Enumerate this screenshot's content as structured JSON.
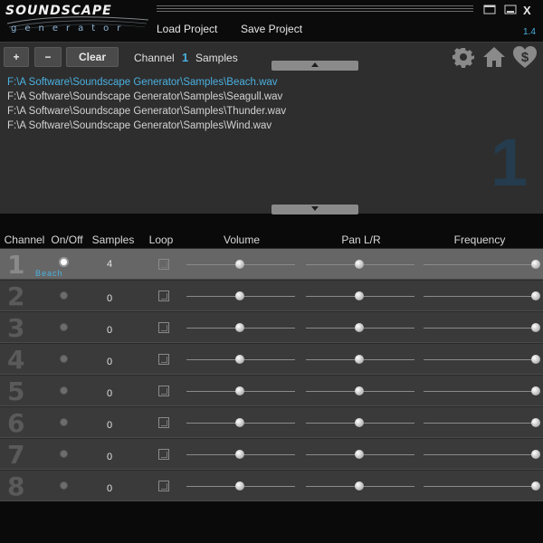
{
  "app": {
    "logo_main": "SOUNDSCAPE",
    "logo_sub": "generator",
    "version": "1.4",
    "close_label": "X"
  },
  "menu": {
    "load_project": "Load Project",
    "save_project": "Save Project"
  },
  "toolbar": {
    "add_label": "+",
    "remove_label": "−",
    "clear_label": "Clear",
    "channel_label": "Channel",
    "channel_value": "1",
    "samples_label": "Samples"
  },
  "files": [
    "F:\\A Software\\Soundscape Generator\\Samples\\Beach.wav",
    "F:\\A Software\\Soundscape Generator\\Samples\\Seagull.wav",
    "F:\\A Software\\Soundscape Generator\\Samples\\Thunder.wav",
    "F:\\A Software\\Soundscape Generator\\Samples\\Wind.wav"
  ],
  "active_file_index": 0,
  "big_channel_number": "1",
  "table": {
    "headers": {
      "channel": "Channel",
      "onoff": "On/Off",
      "samples": "Samples",
      "loop": "Loop",
      "volume": "Volume",
      "pan": "Pan L/R",
      "frequency": "Frequency"
    },
    "rows": [
      {
        "num": "1",
        "selected": true,
        "on": true,
        "sample_name": "Beach",
        "count": "4",
        "volume": 0.49,
        "pan": 0.49,
        "frequency": 1.0
      },
      {
        "num": "2",
        "selected": false,
        "on": false,
        "sample_name": "",
        "count": "0",
        "volume": 0.49,
        "pan": 0.49,
        "frequency": 1.0
      },
      {
        "num": "3",
        "selected": false,
        "on": false,
        "sample_name": "",
        "count": "0",
        "volume": 0.49,
        "pan": 0.49,
        "frequency": 1.0
      },
      {
        "num": "4",
        "selected": false,
        "on": false,
        "sample_name": "",
        "count": "0",
        "volume": 0.49,
        "pan": 0.49,
        "frequency": 1.0
      },
      {
        "num": "5",
        "selected": false,
        "on": false,
        "sample_name": "",
        "count": "0",
        "volume": 0.49,
        "pan": 0.49,
        "frequency": 1.0
      },
      {
        "num": "6",
        "selected": false,
        "on": false,
        "sample_name": "",
        "count": "0",
        "volume": 0.49,
        "pan": 0.49,
        "frequency": 1.0
      },
      {
        "num": "7",
        "selected": false,
        "on": false,
        "sample_name": "",
        "count": "0",
        "volume": 0.49,
        "pan": 0.49,
        "frequency": 1.0
      },
      {
        "num": "8",
        "selected": false,
        "on": false,
        "sample_name": "",
        "count": "0",
        "volume": 0.49,
        "pan": 0.49,
        "frequency": 1.0
      }
    ]
  },
  "colors": {
    "accent": "#4ab0e0",
    "selected_row": "#666666",
    "row": "#3a3a3a",
    "panel": "#2e2e2e"
  },
  "icons": [
    "settings-gear-icon",
    "home-icon",
    "donate-heart-dollar-icon",
    "window-icon",
    "minimize-icon",
    "scroll-up-icon",
    "scroll-down-icon"
  ]
}
